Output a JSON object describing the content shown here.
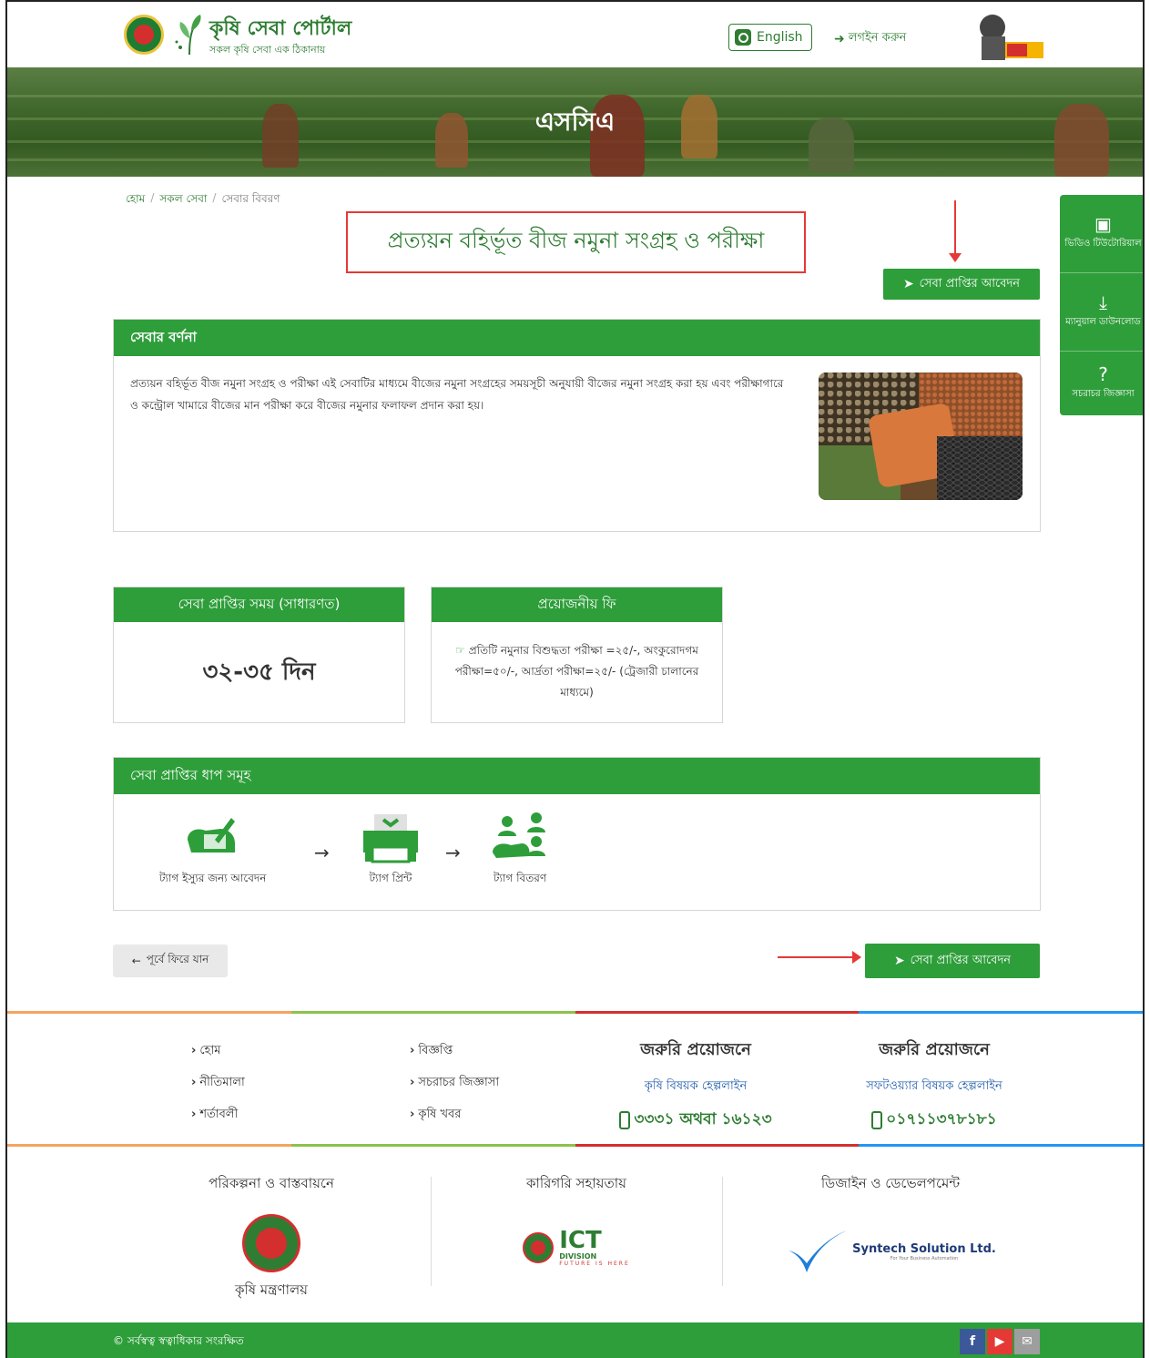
{
  "header": {
    "brand_title": "কৃষি সেবা পোর্টাল",
    "brand_subtitle": "সকল কৃষি সেবা এক ঠিকানায়",
    "language_label": "English",
    "login_label": "লগইন করুন"
  },
  "banner": {
    "title": "এসসিএ"
  },
  "breadcrumb": {
    "items": [
      "হোম",
      "সকল সেবা",
      "সেবার বিবরণ"
    ],
    "separator": "/"
  },
  "page": {
    "title": "প্রত্যয়ন বহির্ভূত বীজ নমুনা সংগ্রহ ও পরীক্ষা",
    "apply_label": "সেবা প্রাপ্তির আবেদন"
  },
  "sidebar": {
    "items": [
      {
        "label": "ভিডিও টিউটোরিয়াল",
        "icon": "video-icon"
      },
      {
        "label": "ম্যানুয়াল ডাউনলোড",
        "icon": "download-icon"
      },
      {
        "label": "সচরাচর জিজ্ঞাসা",
        "icon": "question-icon"
      }
    ]
  },
  "description": {
    "heading": "সেবার বর্ণনা",
    "text": "প্রত্যয়ন বহির্ভূত বীজ নমুনা সংগ্রহ ও পরীক্ষা এই সেবাটির মাধ্যমে বীজের নমুনা সংগ্রহের সময়সূচী অনুযায়ী বীজের নমুনা সংগ্রহ করা হয় এবং পরীক্ষাগারে ও কন্ট্রোল খামারে বীজের মান পরীক্ষা করে বীজের নমুনার ফলাফল প্রদান করা হয়।"
  },
  "service_time": {
    "heading": "সেবা প্রাপ্তির সময় (সাধারণত)",
    "value": "৩২-৩৫ দিন"
  },
  "fee": {
    "heading": "প্রয়োজনীয় ফি",
    "text": "প্রতিটি নমুনার বিশুদ্ধতা পরীক্ষা =২৫/-, অংকুরোদগম পরীক্ষা=৫০/-, আর্দ্রতা পরীক্ষা=২৫/- (ট্রেজারী চালানের মাধ্যমে)"
  },
  "steps": {
    "heading": "সেবা প্রাপ্তির ধাপ সমূহ",
    "items": [
      {
        "label": "ট্যাগ ইস্যুর জন্য আবেদন",
        "icon": "application-icon"
      },
      {
        "label": "ট্যাগ প্রিন্ট",
        "icon": "printer-icon"
      },
      {
        "label": "ট্যাগ বিতরণ",
        "icon": "distribution-icon"
      }
    ],
    "arrow": "→"
  },
  "back_label": "পূর্বে ফিরে যান",
  "footer": {
    "links_col1": [
      "হোম",
      "নীতিমালা",
      "শর্তাবলী"
    ],
    "links_col2": [
      "বিজ্ঞপ্তি",
      "সচরাচর জিজ্ঞাসা",
      "কৃষি খবর"
    ],
    "help1": {
      "title": "জরুরি প্রয়োজনে",
      "subtitle": "কৃষি বিষয়ক হেল্পলাইন",
      "number": "৩৩৩১ অথবা ১৬১২৩"
    },
    "help2": {
      "title": "জরুরি প্রয়োজনে",
      "subtitle": "সফটওয়্যার বিষয়ক হেল্পলাইন",
      "number": "০১৭১১৩৭৮১৮১"
    },
    "line_colors": [
      "#f4a460",
      "#8bc34a",
      "#d32f2f",
      "#2196f3"
    ]
  },
  "partners": {
    "planning": {
      "title": "পরিকল্পনা ও বাস্তবায়নে",
      "name": "কৃষি মন্ত্রণালয়"
    },
    "technical": {
      "title": "কারিগরি সহায়তায়",
      "logo_big": "ICT",
      "logo_small": "DIVISION",
      "logo_tag": "FUTURE IS HERE"
    },
    "design": {
      "title": "ডিজাইন ও ডেভেলপমেন্ট",
      "logo_name": "Syntech Solution Ltd.",
      "logo_tag": "For Your Business Automation"
    }
  },
  "bottom": {
    "copyright": "© সর্বস্বত্ব স্বত্বাধিকার সংরক্ষিত",
    "social": [
      "f",
      "▶",
      "✉"
    ]
  },
  "colors": {
    "primary": "#2e9e3a",
    "annotation_red": "#e53935"
  }
}
